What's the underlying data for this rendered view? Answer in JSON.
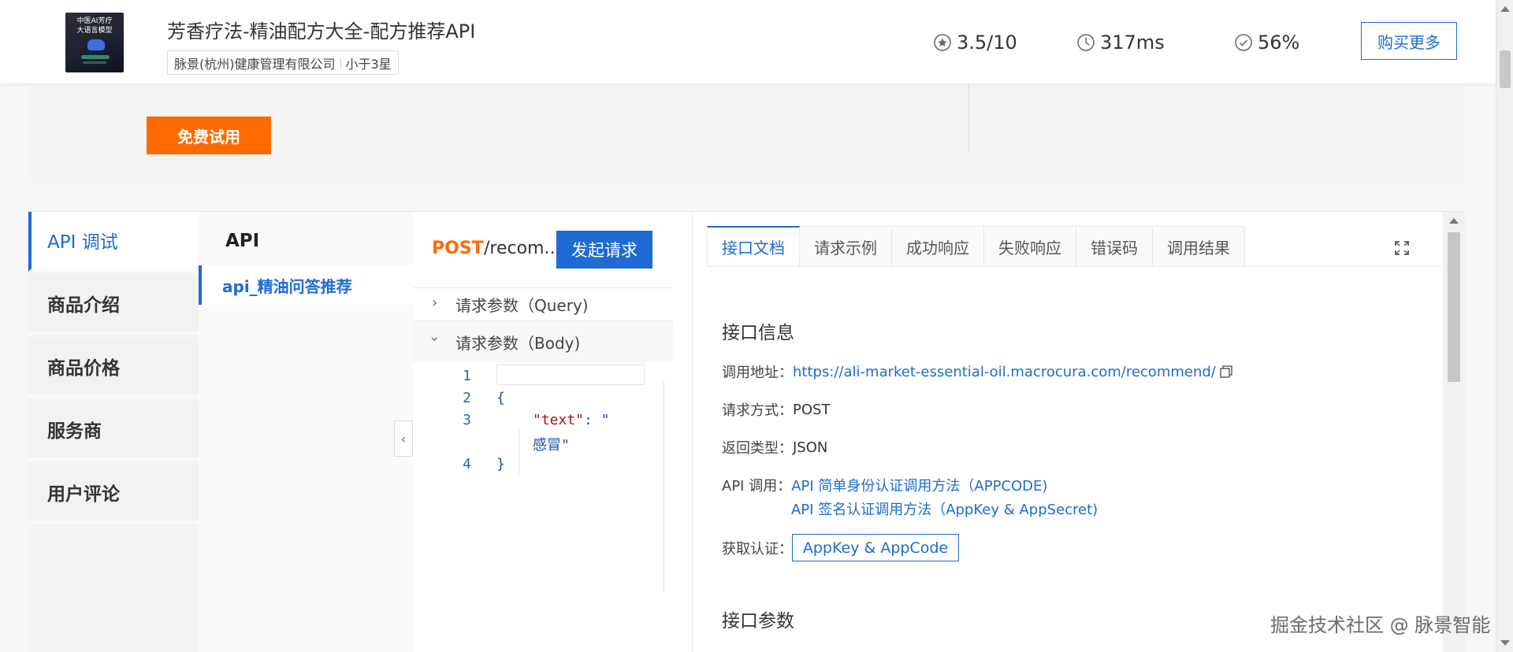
{
  "product": {
    "logo_line1": "中医AI芳疗",
    "logo_line2": "大语言模型",
    "title": "芳香疗法-精油配方大全-配方推荐API",
    "vendor": "脉景(杭州)健康管理有限公司",
    "rating_tag": "小于3星"
  },
  "stats": {
    "rating": "3.5/10",
    "latency": "317ms",
    "success_rate": "56%"
  },
  "header": {
    "buy_more": "购买更多"
  },
  "trial": {
    "free_label": "免费试用"
  },
  "left_nav": {
    "items": [
      {
        "label": "API 调试"
      },
      {
        "label": "商品介绍"
      },
      {
        "label": "商品价格"
      },
      {
        "label": "服务商"
      },
      {
        "label": "用户评论"
      }
    ]
  },
  "api_list": {
    "header": "API",
    "items": [
      {
        "label": "api_精油问答推荐"
      }
    ]
  },
  "request": {
    "method": "POST",
    "path": "/recom...",
    "send_label": "发起请求",
    "query_section": "请求参数（Query)",
    "body_section": "请求参数（Body)",
    "code_lines": [
      "1",
      "2",
      "3",
      "4"
    ],
    "brace_open": "{",
    "key": "\"text\"",
    "colon": ": ",
    "val_part1": "\"",
    "val_part2": "感冒\"",
    "brace_close": "}"
  },
  "doc": {
    "tabs": [
      "接口文档",
      "请求示例",
      "成功响应",
      "失败响应",
      "错误码",
      "调用结果"
    ],
    "section_info": "接口信息",
    "url_label": "调用地址：",
    "url": "https://ali-market-essential-oil.macrocura.com/recommend/",
    "method_label": "请求方式：",
    "method_value": "POST",
    "return_label": "返回类型：",
    "return_value": "JSON",
    "api_call_label": "API 调用：",
    "api_call_link1": "API 简单身份认证调用方法（APPCODE)",
    "api_call_link2": "API 签名认证调用方法（AppKey & AppSecret)",
    "auth_label": "获取认证：",
    "auth_button": "AppKey & AppCode",
    "section_params": "接口参数"
  },
  "watermark": "掘金技术社区 @ 脉景智能",
  "colors": {
    "accent_blue": "#1d6bd3",
    "orange": "#ff6a00"
  }
}
